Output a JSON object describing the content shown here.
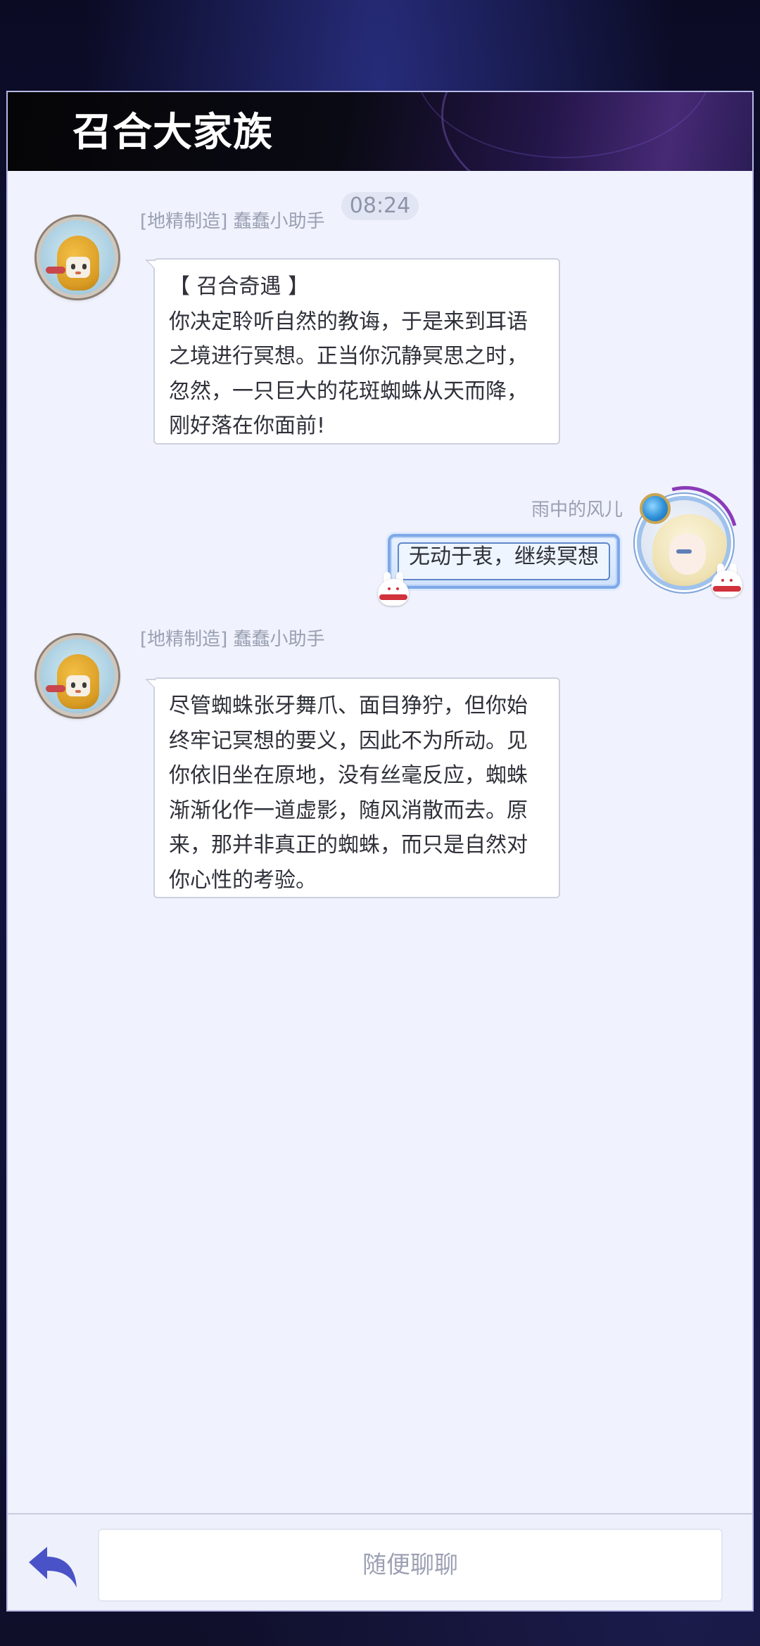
{
  "window": {
    "title": "召合大家族"
  },
  "chat": {
    "timestamp": "08:24",
    "messages": [
      {
        "side": "left",
        "sender": "[地精制造] 蠢蠢小助手",
        "avatar_icon": "robot-avatar-icon",
        "lines": [
          "【 召合奇遇 】",
          "你决定聆听自然的教诲，于是来到耳语",
          "之境进行冥想。正当你沉静冥思之时，",
          "忽然，一只巨大的花斑蜘蛛从天而降，",
          "刚好落在你面前!"
        ]
      },
      {
        "side": "right",
        "sender": "雨中的风儿",
        "avatar_icon": "player-avatar-icon",
        "text": "无动于衷，继续冥想"
      },
      {
        "side": "left",
        "sender": "[地精制造] 蠢蠢小助手",
        "avatar_icon": "robot-avatar-icon",
        "lines": [
          "尽管蜘蛛张牙舞爪、面目狰狞，但你始",
          "终牢记冥想的要义，因此不为所动。见",
          "你依旧坐在原地，没有丝毫反应，蜘蛛",
          "渐渐化作一道虚影，随风消散而去。原",
          "来，那并非真正的蜘蛛，而只是自然对",
          "你心性的考验。"
        ]
      }
    ]
  },
  "input": {
    "placeholder": "随便聊聊",
    "back_icon": "back-arrow-icon"
  },
  "colors": {
    "header_bg": "#050507",
    "panel_bg": "#f0f2fd",
    "accent_back": "#4a52c8",
    "bubble_right_border": "#7da8e8"
  }
}
